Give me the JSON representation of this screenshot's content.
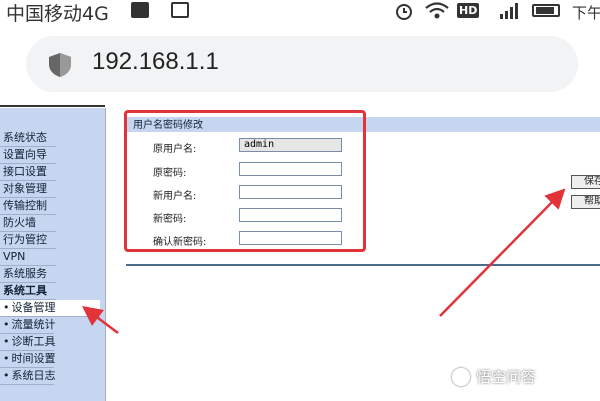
{
  "status_bar": {
    "carrier": "中国移动4G",
    "network_badge": "HD",
    "time": "下午"
  },
  "browser": {
    "url": "192.168.1.1"
  },
  "sidebar": {
    "items": [
      {
        "label": "系统状态"
      },
      {
        "label": "设置向导"
      },
      {
        "label": "接口设置"
      },
      {
        "label": "对象管理"
      },
      {
        "label": "传输控制"
      },
      {
        "label": "防火墙"
      },
      {
        "label": "行为管控"
      },
      {
        "label": "VPN"
      },
      {
        "label": "系统服务"
      },
      {
        "label": "系统工具"
      },
      {
        "label": "设备管理"
      },
      {
        "label": "流量统计"
      },
      {
        "label": "诊断工具"
      },
      {
        "label": "时间设置"
      },
      {
        "label": "系统日志"
      }
    ]
  },
  "form": {
    "title": "用户名密码修改",
    "fields": [
      {
        "label": "原用户名:",
        "value": "admin"
      },
      {
        "label": "原密码:",
        "value": ""
      },
      {
        "label": "新用户名:",
        "value": ""
      },
      {
        "label": "新密码:",
        "value": ""
      },
      {
        "label": "确认新密码:",
        "value": ""
      }
    ]
  },
  "buttons": {
    "save": "保存",
    "help": "帮助"
  },
  "watermark": {
    "text": "悟空问答"
  },
  "colors": {
    "highlight": "#e0333a",
    "sidebar_bg": "#c7d6f0"
  }
}
